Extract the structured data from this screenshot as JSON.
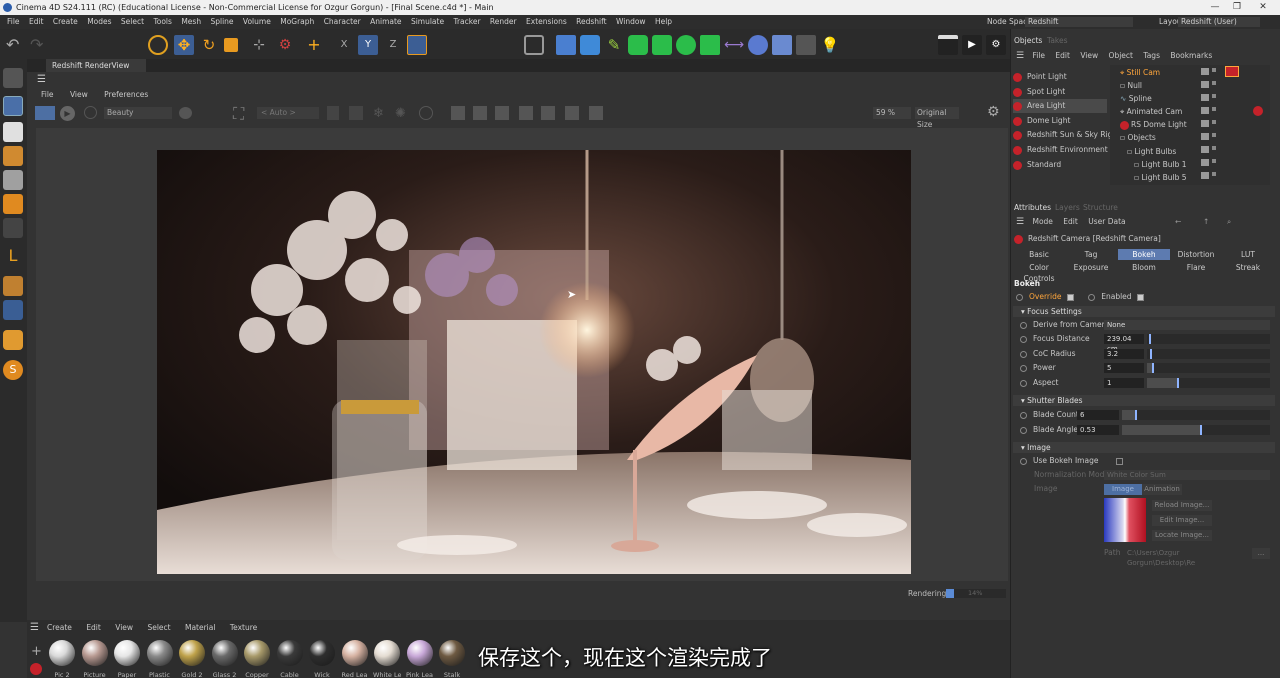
{
  "window": {
    "title": "Cinema 4D S24.111 (RC) (Educational License - Non-Commercial License for Ozgur Gorgun) - [Final Scene.c4d *] - Main",
    "node_space_label": "Node Space:",
    "node_space_value": "Redshift",
    "layout_label": "Layout:",
    "layout_value": "Redshift (User)"
  },
  "menu": [
    "File",
    "Edit",
    "Create",
    "Modes",
    "Select",
    "Tools",
    "Mesh",
    "Spline",
    "Volume",
    "MoGraph",
    "Character",
    "Animate",
    "Simulate",
    "Tracker",
    "Render",
    "Extensions",
    "Redshift",
    "Window",
    "Help"
  ],
  "renderview": {
    "tab_label": "Redshift RenderView",
    "menu": [
      "File",
      "View",
      "Preferences"
    ],
    "aov": "Beauty",
    "auto": "< Auto >",
    "zoom": "59 %",
    "size": "Original Size",
    "status_label": "Rendering",
    "status_percent": "14%"
  },
  "materials": {
    "menu": [
      "Create",
      "Edit",
      "View",
      "Select",
      "Material",
      "Texture"
    ],
    "items": [
      {
        "label": "Pic 2",
        "color": "#d9d9d9"
      },
      {
        "label": "Picture",
        "color": "#b89a92"
      },
      {
        "label": "Paper",
        "color": "#e6e6e6"
      },
      {
        "label": "Plastic",
        "color": "#8a8a8a"
      },
      {
        "label": "Gold 2",
        "color": "#bfa24a"
      },
      {
        "label": "Glass 2",
        "color": "#6a6a6a"
      },
      {
        "label": "Copper",
        "color": "#a89a6a"
      },
      {
        "label": "Cable",
        "color": "#3a3a3a"
      },
      {
        "label": "Wick",
        "color": "#2e2e2e"
      },
      {
        "label": "Red Lea",
        "color": "#d6b2a2"
      },
      {
        "label": "White Le",
        "color": "#e4dcd2"
      },
      {
        "label": "Pink Lea",
        "color": "#c8a8d8"
      },
      {
        "label": "Stalk",
        "color": "#6e5a42"
      }
    ],
    "subtitle": "保存这个，现在这个渲染完成了"
  },
  "objects_panel": {
    "tabs": [
      "Objects",
      "Takes"
    ],
    "menu": [
      "File",
      "Edit",
      "View",
      "Object",
      "Tags",
      "Bookmarks"
    ],
    "lights": [
      "Point Light",
      "Spot Light",
      "Area Light",
      "Dome Light",
      "Redshift Sun & Sky Rig",
      "Redshift Environment",
      "Standard"
    ],
    "tree": [
      "Still Cam",
      "Null",
      "Spline",
      "Animated Cam",
      "RS Dome Light",
      "Objects",
      "Light Bulbs",
      "Light Bulb 1",
      "Light Bulb 5"
    ]
  },
  "attributes": {
    "tabs": [
      "Attributes",
      "Layers",
      "Structure"
    ],
    "menu": [
      "Mode",
      "Edit",
      "User Data"
    ],
    "object": "Redshift Camera [Redshift Camera]",
    "tabs_row1": [
      "Basic",
      "Tag",
      "Bokeh",
      "Distortion",
      "LUT"
    ],
    "tabs_row2": [
      "Color Controls",
      "Exposure",
      "Bloom",
      "Flare",
      "Streak"
    ],
    "section_title": "Bokeh",
    "override": "Override",
    "enabled": "Enabled",
    "focus_settings": "Focus Settings",
    "derive_label": "Derive from Camera",
    "derive_value": "None",
    "focus_distance_label": "Focus Distance",
    "focus_distance_value": "239.04 cm",
    "coc_label": "CoC Radius",
    "coc_value": "3.2",
    "power_label": "Power",
    "power_value": "5",
    "aspect_label": "Aspect",
    "aspect_value": "1",
    "shutter_blades": "Shutter Blades",
    "blade_count_label": "Blade Count",
    "blade_count_value": "6",
    "blade_angle_label": "Blade Angle",
    "blade_angle_value": "0.53",
    "image_section": "Image",
    "use_bokeh_label": "Use Bokeh Image",
    "norm_label": "Normalization Mode",
    "norm_value": "White Color Sum",
    "image_label": "Image",
    "image_tab1": "Image",
    "image_tab2": "Animation",
    "reload_btn": "Reload Image...",
    "edit_btn": "Edit Image...",
    "locate_btn": "Locate Image...",
    "path_label": "Path",
    "path_value": "C:\\Users\\Ozgur Gorgun\\Desktop\\Re"
  },
  "colors": {
    "accent": "#5b8bd6",
    "active_tab": "#5d7bb0",
    "red_icon": "#c5222a",
    "selection": "#ffa63c"
  }
}
